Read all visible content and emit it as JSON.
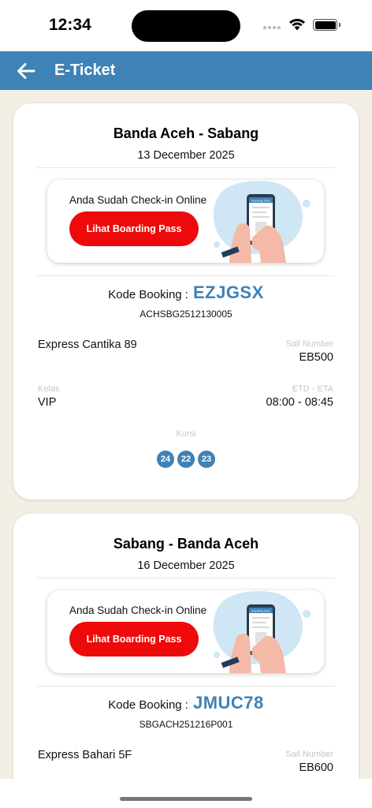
{
  "status_bar": {
    "time": "12:34"
  },
  "header": {
    "title": "E-Ticket"
  },
  "tickets": [
    {
      "route": "Banda Aceh - Sabang",
      "date": "13 December 2025",
      "checkin_text": "Anda Sudah Check-in Online",
      "boarding_pass_button": "Lihat Boarding Pass",
      "phone_screen_label": "Boarding Pass",
      "booking_label": "Kode Booking :",
      "booking_code": "EZJGSX",
      "booking_ref": "ACHSBG2512130005",
      "vessel": "Express Cantika 89",
      "sail_number_label": "Sail Number",
      "sail_number": "EB500",
      "class_label": "Kelas",
      "class_value": "VIP",
      "etd_eta_label": "ETD - ETA",
      "etd_eta": "08:00 - 08:45",
      "seat_label": "Kursi",
      "seats": [
        "24",
        "22",
        "23"
      ]
    },
    {
      "route": "Sabang - Banda Aceh",
      "date": "16 December 2025",
      "checkin_text": "Anda Sudah Check-in Online",
      "boarding_pass_button": "Lihat Boarding Pass",
      "phone_screen_label": "Boarding Pass",
      "booking_label": "Kode Booking :",
      "booking_code": "JMUC78",
      "booking_ref": "SBGACH251216P001",
      "vessel": "Express Bahari 5F",
      "sail_number_label": "Sail Number",
      "sail_number": "EB600"
    }
  ],
  "colors": {
    "primary": "#3e82b6",
    "button_red": "#ee0a0a",
    "background": "#f3efe5"
  }
}
